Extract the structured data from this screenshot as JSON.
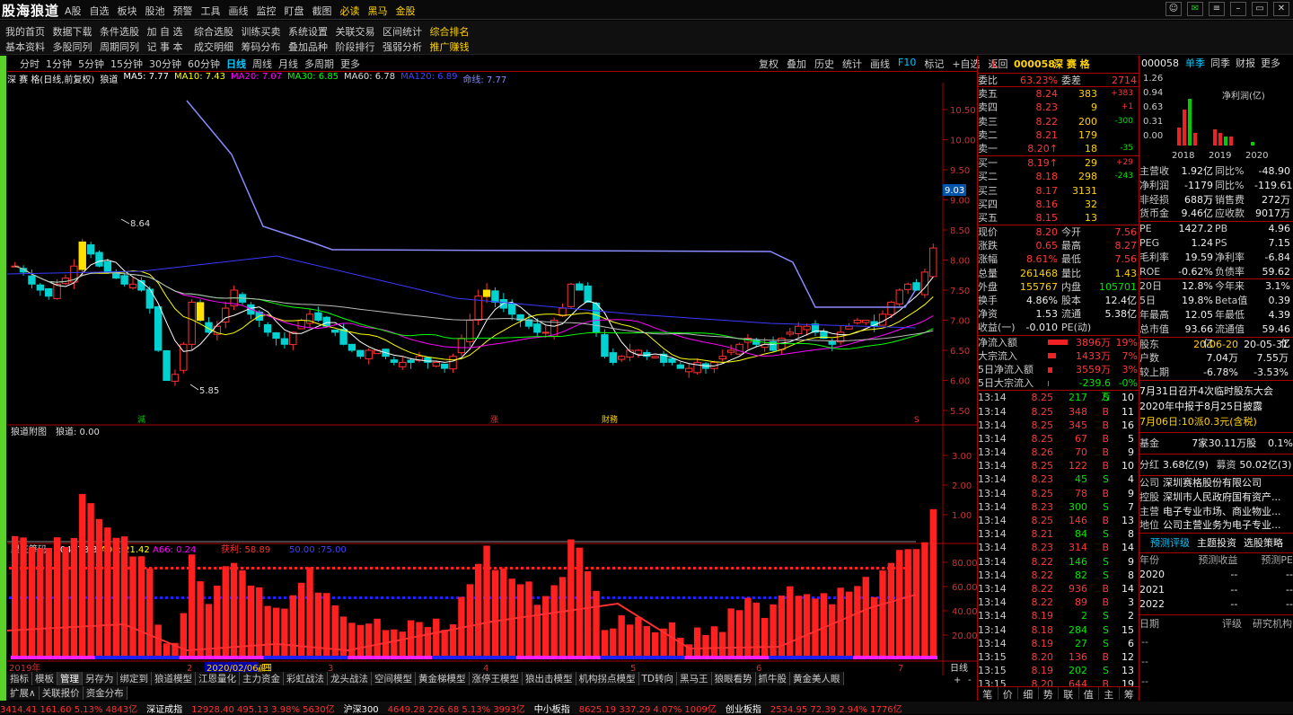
{
  "app": {
    "logo": "股海狼道",
    "menu": [
      "A股",
      "自选",
      "板块",
      "股池",
      "预警",
      "工具",
      "画线",
      "监控",
      "盯盘",
      "截图",
      "必读",
      "黑马",
      "金股"
    ]
  },
  "nav": {
    "row1": [
      "我的首页",
      "数据下载",
      "条件选股",
      "加 自 选",
      "综合选股",
      "训练买卖",
      "系统设置",
      "关联交易",
      "区间统计",
      "综合排名"
    ],
    "row2": [
      "基本资料",
      "多股同列",
      "周期同列",
      "记 事 本",
      "成交明细",
      "筹码分布",
      "叠加品种",
      "阶段排行",
      "强弱分析",
      "推广赚钱"
    ]
  },
  "period_toolbar": [
    "分时",
    "1分钟",
    "5分钟",
    "15分钟",
    "30分钟",
    "60分钟",
    "日线",
    "周线",
    "月线",
    "多周期",
    "更多"
  ],
  "right_toolbar": [
    "复权",
    "叠加",
    "历史",
    "统计",
    "画线",
    "F10",
    "标记",
    "+自选",
    "返回"
  ],
  "chart_legend": {
    "name": "深 赛 格(日线,前复权)",
    "indicator": "狼道",
    "items": [
      {
        "t": "MA5: 7.77",
        "c": "#ffffff"
      },
      {
        "t": "MA10: 7.43",
        "c": "#ffff00"
      },
      {
        "t": "MA20: 7.07",
        "c": "#ff00ff"
      },
      {
        "t": "MA30: 6.85",
        "c": "#00ff00"
      },
      {
        "t": "MA60: 6.78",
        "c": "#dddddd"
      },
      {
        "t": "MA120: 6.89",
        "c": "#4444ff"
      },
      {
        "t": "命线: 7.77",
        "c": "#8888ff"
      }
    ]
  },
  "chart_data": {
    "type": "line",
    "price_axis": [
      "10.50",
      "10.00",
      "9.50",
      "9.00",
      "8.50",
      "8.00",
      "7.50",
      "7.00",
      "6.50",
      "6.00",
      "5.50"
    ],
    "high_label": "8.64",
    "low_label": "5.85",
    "cursor_price": "9.03",
    "markers": [
      "減",
      "涨",
      "財務",
      "S"
    ],
    "sub1": {
      "title": "狼道附图",
      "value": "狼道: 0.00",
      "axis": [
        "3.00",
        "2.00",
        "1.00"
      ]
    },
    "sub2": {
      "title": "跟庄筹码",
      "items": [
        {
          "t": "A04: 78.33",
          "c": "#ffffff"
        },
        {
          "t": "A08: 21.42",
          "c": "#ffff00"
        },
        {
          "t": "A66: 0.24",
          "c": "#ff00ff"
        },
        {
          "t": "获利: 58.89",
          "c": "#ff3030"
        },
        {
          "t": "50.00 :75.00",
          "c": "#4040ff"
        }
      ],
      "axis": [
        "80.00",
        "60.00",
        "40.00",
        "20.00"
      ]
    },
    "x_labels": [
      "2019年",
      "2",
      "2020/02/06/四",
      "3",
      "4",
      "5",
      "6",
      "7"
    ],
    "period": "日线"
  },
  "quote": {
    "flag": "L",
    "code": "000058",
    "name": "深 赛 格",
    "weibi": "63.23%",
    "weicha_label": "委差",
    "weicha": "2714",
    "sell": [
      {
        "l": "卖五",
        "p": "8.24",
        "v": "383",
        "d": "+383"
      },
      {
        "l": "卖四",
        "p": "8.23",
        "v": "9",
        "d": "+1"
      },
      {
        "l": "卖三",
        "p": "8.22",
        "v": "200",
        "d": "-300"
      },
      {
        "l": "卖二",
        "p": "8.21",
        "v": "179",
        "d": ""
      },
      {
        "l": "卖一",
        "p": "8.20↑",
        "v": "18",
        "d": "-35"
      }
    ],
    "buy": [
      {
        "l": "买一",
        "p": "8.19↑",
        "v": "29",
        "d": "+29"
      },
      {
        "l": "买二",
        "p": "8.18",
        "v": "298",
        "d": "-243"
      },
      {
        "l": "买三",
        "p": "8.17",
        "v": "3131",
        "d": ""
      },
      {
        "l": "买四",
        "p": "8.16",
        "v": "32",
        "d": ""
      },
      {
        "l": "买五",
        "p": "8.15",
        "v": "13",
        "d": ""
      }
    ],
    "stats": [
      [
        "现价",
        "8.20",
        "今开",
        "7.56"
      ],
      [
        "涨跌",
        "0.65",
        "最高",
        "8.27"
      ],
      [
        "涨幅",
        "8.61%",
        "最低",
        "7.56"
      ],
      [
        "总量",
        "261468",
        "量比",
        "1.43"
      ],
      [
        "外盘",
        "155767",
        "内盘",
        "105701"
      ],
      [
        "换手",
        "4.86%",
        "股本",
        "12.4亿"
      ],
      [
        "净资",
        "1.53",
        "流通",
        "5.38亿"
      ],
      [
        "收益(一)",
        "-0.010",
        "PE(动)",
        ""
      ]
    ],
    "flows": [
      [
        "净流入额",
        "3896万",
        "19%"
      ],
      [
        "大宗流入",
        "1433万",
        "7%"
      ],
      [
        "5日净流入额",
        "3559万",
        "3%"
      ],
      [
        "5日大宗流入",
        "-239.6万",
        "-0%"
      ]
    ],
    "ticks": [
      [
        "13:14",
        "8.25",
        "217",
        "S",
        "10"
      ],
      [
        "13:14",
        "8.25",
        "348",
        "B",
        "11"
      ],
      [
        "13:14",
        "8.25",
        "345",
        "B",
        "16"
      ],
      [
        "13:14",
        "8.25",
        "67",
        "B",
        "5"
      ],
      [
        "13:14",
        "8.26",
        "70",
        "B",
        "9"
      ],
      [
        "13:14",
        "8.25",
        "122",
        "B",
        "10"
      ],
      [
        "13:14",
        "8.23",
        "45",
        "S",
        "4"
      ],
      [
        "13:14",
        "8.25",
        "78",
        "B",
        "9"
      ],
      [
        "13:14",
        "8.23",
        "300",
        "S",
        "7"
      ],
      [
        "13:14",
        "8.25",
        "146",
        "B",
        "13"
      ],
      [
        "13:14",
        "8.21",
        "84",
        "S",
        "8"
      ],
      [
        "13:14",
        "8.23",
        "314",
        "B",
        "14"
      ],
      [
        "13:14",
        "8.22",
        "146",
        "S",
        "9"
      ],
      [
        "13:14",
        "8.22",
        "82",
        "S",
        "8"
      ],
      [
        "13:14",
        "8.22",
        "936",
        "B",
        "14"
      ],
      [
        "13:14",
        "8.22",
        "89",
        "B",
        "3"
      ],
      [
        "13:14",
        "8.19",
        "2",
        "S",
        "2"
      ],
      [
        "13:14",
        "8.18",
        "284",
        "S",
        "15"
      ],
      [
        "13:14",
        "8.19",
        "27",
        "S",
        "6"
      ],
      [
        "13:15",
        "8.20",
        "136",
        "B",
        "12"
      ],
      [
        "13:15",
        "8.19",
        "202",
        "S",
        "13"
      ],
      [
        "13:15",
        "8.20",
        "644",
        "B",
        "19"
      ]
    ],
    "bottom_tabs": [
      "笔",
      "价",
      "细",
      "势",
      "联",
      "值",
      "主",
      "筹"
    ]
  },
  "fin": {
    "code": "000058",
    "tabs": [
      "单季",
      "同季",
      "财报",
      "更多"
    ],
    "chart_title": "净利润(亿)",
    "chart_axis": [
      "1.26",
      "0.94",
      "0.63",
      "0.31",
      "0.00"
    ],
    "years": [
      "2018",
      "2019",
      "2020"
    ],
    "rows1": [
      [
        "主营收",
        "1.92亿",
        "同比%",
        "-48.90"
      ],
      [
        "净利润",
        "-1179万",
        "同比%",
        "-119.61"
      ],
      [
        "非经损",
        "688万",
        "销售费",
        "272万"
      ],
      [
        "货币金",
        "9.46亿",
        "应收款",
        "9017万"
      ]
    ],
    "rows2": [
      [
        "PE",
        "1427.2",
        "PB",
        "4.96"
      ],
      [
        "PEG",
        "1.24",
        "PS",
        "7.15"
      ],
      [
        "毛利率",
        "19.59",
        "净利率",
        "-6.84"
      ],
      [
        "ROE",
        "-0.62%",
        "负债率",
        "59.62"
      ]
    ],
    "rows3": [
      [
        "20日",
        "12.8%",
        "今年来",
        "3.1%"
      ],
      [
        "5日",
        "19.8%",
        "Beta值",
        "0.39"
      ],
      [
        "年最高",
        "12.05",
        "年最低",
        "4.39"
      ],
      [
        "总市值",
        "93.66亿",
        "流通值",
        "59.46亿"
      ]
    ],
    "holders": {
      "label": "股东",
      "d1": "20-06-20",
      "d2": "20-05-31",
      "r1": [
        "户数",
        "7.04万",
        "7.55万"
      ],
      "r2": [
        "较上期",
        "-6.78%",
        "-3.53%"
      ]
    },
    "news": [
      "7月31日召开4次临时股东大会",
      "2020年中报于8月25日披露",
      "7月06日:10派0.3元(含税)"
    ],
    "fund": [
      "基金",
      "7家",
      "30.11万股",
      "0.1%"
    ],
    "dividend": [
      "分红",
      "3.68亿(9)",
      "募资",
      "50.02亿(3)"
    ],
    "company": [
      [
        "公司",
        "深圳赛格股份有限公司"
      ],
      [
        "控股",
        "深圳市人民政府国有资产..."
      ],
      [
        "主营",
        "电子专业市场、商业物业..."
      ],
      [
        "地位",
        "公司主营业务为电子专业..."
      ]
    ],
    "forecast_tabs": [
      "预测评级",
      "主题投资",
      "选股策略"
    ],
    "forecast_head": [
      "年份",
      "预测收益",
      "预测PE"
    ],
    "forecast_rows": [
      [
        "2020",
        "--",
        "--"
      ],
      [
        "2021",
        "--",
        "--"
      ],
      [
        "2022",
        "--",
        "--"
      ]
    ],
    "rating_head": [
      "日期",
      "评级",
      "研究机构"
    ]
  },
  "tabs_row1": [
    "指标",
    "模板",
    "管理",
    "另存为",
    "绑定到",
    "狼道模型",
    "江恩量化",
    "主力资金",
    "彩虹战法",
    "龙头战法",
    "空间模型",
    "黄金梯模型",
    "涨停王模型",
    "狼出击模型",
    "机构拐点模型",
    "TD转向",
    "黑马王",
    "狼眼看势",
    "抓牛股",
    "黄金美人眼"
  ],
  "tabs_row2": [
    "扩展∧",
    "关联报价",
    "资金分布"
  ],
  "status": [
    {
      "t": "3414.41  161.60  5.13% 4843亿",
      "c": "#ff3030"
    },
    {
      "t": "深证成指",
      "c": "#ffffff"
    },
    {
      "t": "12928.40  495.13  3.98% 5630亿",
      "c": "#ff3030"
    },
    {
      "t": "沪深300",
      "c": "#ffffff"
    },
    {
      "t": "4649.28  226.68  5.13% 3993亿",
      "c": "#ff3030"
    },
    {
      "t": "中小板指",
      "c": "#ffffff"
    },
    {
      "t": "8625.19  337.29  4.07%  1009亿",
      "c": "#ff3030"
    },
    {
      "t": "创业板指",
      "c": "#ffffff"
    },
    {
      "t": "2534.95  72.39  2.94% 1776亿",
      "c": "#ff3030"
    }
  ]
}
